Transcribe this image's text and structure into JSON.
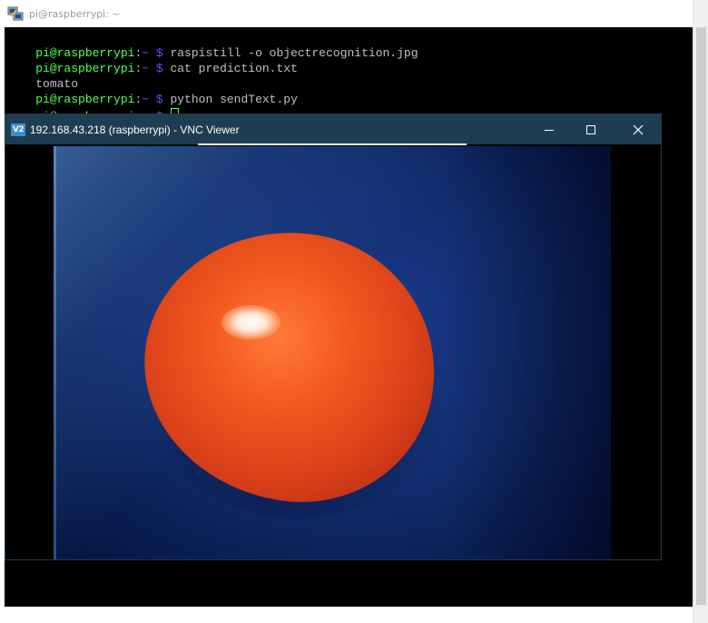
{
  "putty": {
    "title": "pi@raspberrypi: ~",
    "lines": [
      {
        "user": "pi@raspberrypi",
        "sep": ":",
        "path": "~ $",
        "command": " raspistill -o objectrecognition.jpg"
      },
      {
        "user": "pi@raspberrypi",
        "sep": ":",
        "path": "~ $",
        "command": " cat prediction.txt"
      },
      {
        "output": "tomato"
      },
      {
        "user": "pi@raspberrypi",
        "sep": ":",
        "path": "~ $",
        "command": " python sendText.py"
      },
      {
        "user": "pi@raspberrypi",
        "sep": ":",
        "path": "~ $",
        "command": " "
      }
    ]
  },
  "vnc": {
    "logo": "V2",
    "title": "192.168.43.218 (raspberrypi) - VNC Viewer",
    "minimize": "minimize-icon",
    "maximize": "maximize-icon",
    "close": "close-icon"
  },
  "colors": {
    "prompt_user": "#55ff55",
    "prompt_path": "#5555ff",
    "vnc_titlebar": "#1f3d52",
    "terminal_bg": "#000000"
  }
}
